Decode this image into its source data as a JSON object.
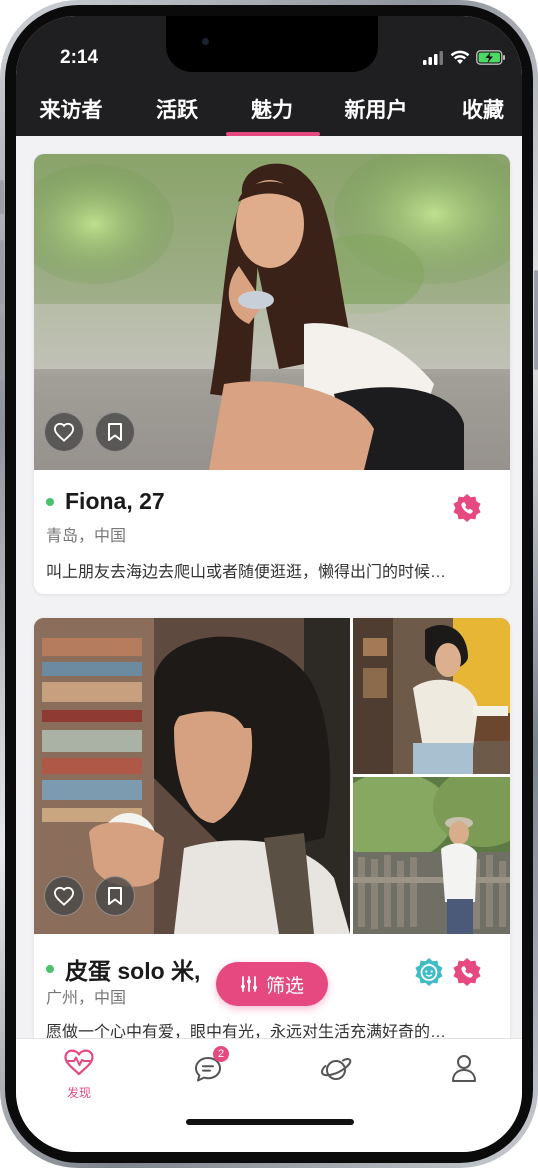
{
  "status_bar": {
    "time": "2:14",
    "icons": [
      "signal-icon",
      "wifi-icon",
      "battery-charging-icon"
    ]
  },
  "tabs": [
    {
      "label": "来访者",
      "active": false
    },
    {
      "label": "活跃",
      "active": false
    },
    {
      "label": "魅力",
      "active": true
    },
    {
      "label": "新用户",
      "active": false
    },
    {
      "label": "收藏",
      "active": false
    }
  ],
  "cards": [
    {
      "name": "Fiona, 27",
      "location": "青岛，中国",
      "bio": "叫上朋友去海边去爬山或者随便逛逛，懒得出门的时候…",
      "online": true,
      "badges": [
        "phone-badge-icon"
      ],
      "actions": [
        "heart-icon",
        "bookmark-icon"
      ]
    },
    {
      "name": "皮蛋 solo 米,",
      "location": "广州，中国",
      "bio": "愿做一个心中有爱，眼中有光，永远对生活充满好奇的…",
      "online": true,
      "badges": [
        "baby-face-badge-icon",
        "phone-badge-icon"
      ],
      "actions": [
        "heart-icon",
        "bookmark-icon"
      ]
    }
  ],
  "filter_button": {
    "label": "筛选",
    "icon": "sliders-icon"
  },
  "bottom_nav": [
    {
      "label": "发现",
      "icon": "heart-pulse-icon",
      "active": true
    },
    {
      "label": "",
      "icon": "chat-icon",
      "badge": "2"
    },
    {
      "label": "",
      "icon": "planet-icon"
    },
    {
      "label": "",
      "icon": "profile-icon"
    }
  ],
  "colors": {
    "accent": "#e6497f",
    "header_bg": "#1f1f21",
    "online": "#4cc06c",
    "badge_teal": "#3fbcc4"
  }
}
